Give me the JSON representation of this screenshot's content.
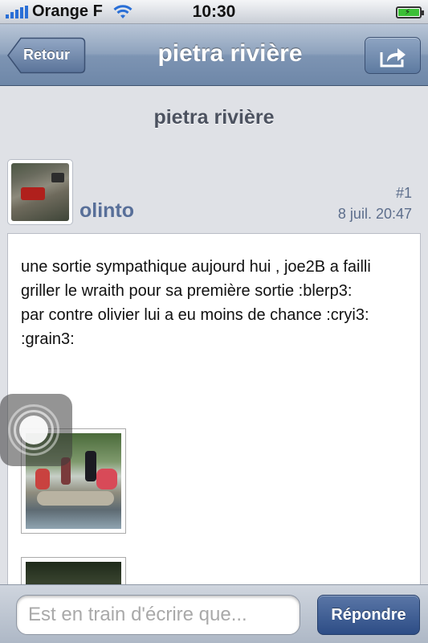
{
  "status_bar": {
    "carrier": "Orange F",
    "time": "10:30",
    "signal_bars": 5,
    "battery_state": "charging"
  },
  "nav": {
    "back_label": "Retour",
    "title": "pietra rivière",
    "share_icon": "share-icon"
  },
  "thread": {
    "title": "pietra rivière"
  },
  "post": {
    "author": "olinto",
    "number": "#1",
    "date": "8 juil. 20:47",
    "text": "une sortie sympathique aujourd hui , joe2B a failli griller le wraith pour sa première sortie :blerp3:\npar contre olivier lui a eu moins de chance :cryi3:  :grain3:"
  },
  "reply": {
    "placeholder": "Est en train d'écrire que...",
    "button_label": "Répondre"
  },
  "colors": {
    "nav_bar": "#7d94b3",
    "author": "#586f99",
    "reply_button": "#2d4d86",
    "background": "#dfe1e6"
  }
}
